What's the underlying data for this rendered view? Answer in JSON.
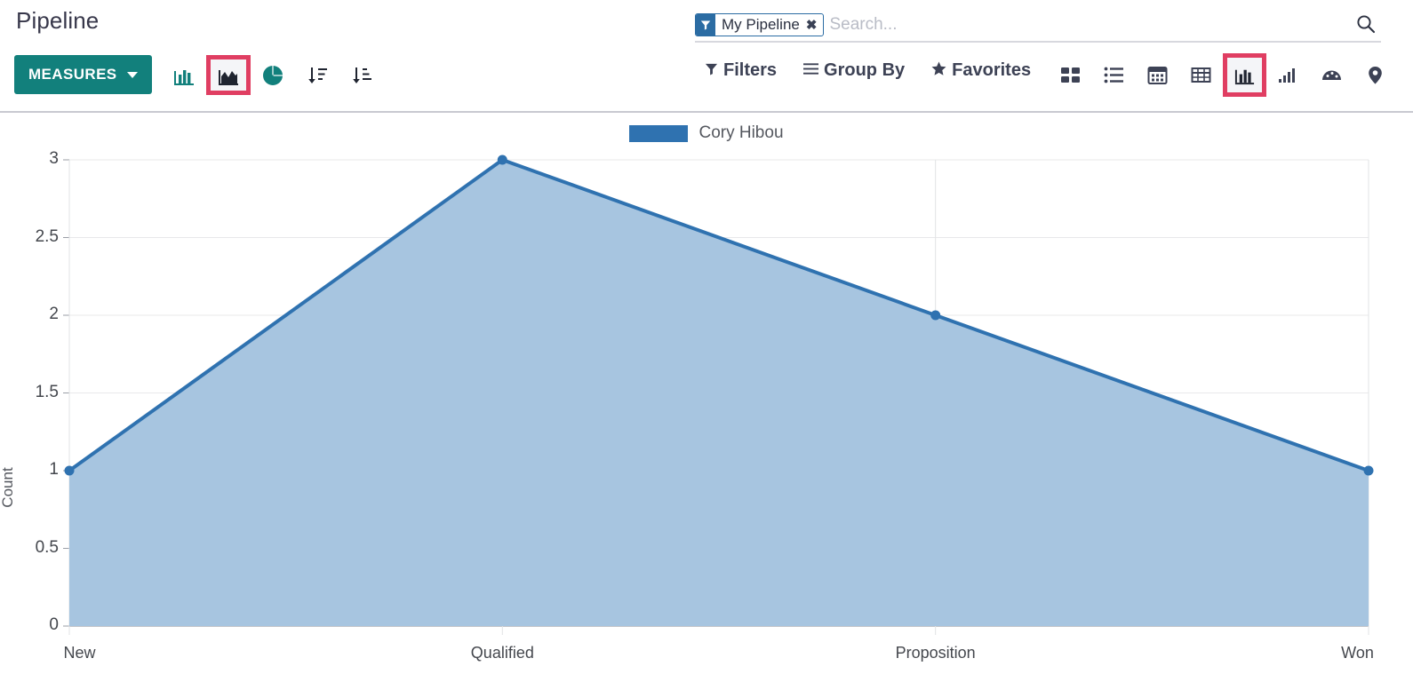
{
  "breadcrumb": "Pipeline",
  "search": {
    "placeholder": "Search...",
    "value": "",
    "facet": {
      "icon": "filter-icon",
      "label": "My Pipeline",
      "remove": "✖"
    },
    "search_icon": "search-icon"
  },
  "toolbar": {
    "measures_label": "MEASURES",
    "chart_tools": [
      {
        "name": "bar-chart-icon",
        "label": "Bar Chart",
        "active": false
      },
      {
        "name": "area-chart-icon",
        "label": "Line Chart",
        "active": true
      },
      {
        "name": "pie-chart-icon",
        "label": "Pie Chart",
        "active": false
      },
      {
        "name": "sort-descending-icon",
        "label": "Descending",
        "active": false
      },
      {
        "name": "sort-ascending-icon",
        "label": "Ascending",
        "active": false
      }
    ],
    "filters": [
      {
        "name": "filters",
        "icon": "funnel-icon",
        "label": "Filters"
      },
      {
        "name": "group-by",
        "icon": "bars-icon",
        "label": "Group By"
      },
      {
        "name": "favorites",
        "icon": "star-icon",
        "label": "Favorites"
      }
    ],
    "views": [
      {
        "name": "kanban-view-icon",
        "label": "Kanban",
        "active": false
      },
      {
        "name": "list-view-icon",
        "label": "List",
        "active": false
      },
      {
        "name": "calendar-view-icon",
        "label": "Calendar",
        "active": false
      },
      {
        "name": "pivot-view-icon",
        "label": "Pivot",
        "active": false
      },
      {
        "name": "graph-view-icon",
        "label": "Graph",
        "active": true
      },
      {
        "name": "cohort-view-icon",
        "label": "Cohort",
        "active": false
      },
      {
        "name": "dashboard-view-icon",
        "label": "Dashboard",
        "active": false
      },
      {
        "name": "map-view-icon",
        "label": "Map",
        "active": false
      }
    ]
  },
  "colors": {
    "brand_teal": "#12807c",
    "highlight_pink": "#e03e62",
    "series_line": "#2f72b0",
    "series_fill": "#a7c5e0",
    "facet_blue": "#2b6ca3"
  },
  "chart_data": {
    "type": "area",
    "title": "",
    "xlabel": "",
    "ylabel": "Count",
    "categories": [
      "New",
      "Qualified",
      "Proposition",
      "Won"
    ],
    "series": [
      {
        "name": "Cory Hibou",
        "values": [
          1,
          3,
          2,
          1
        ],
        "color": "#2f72b0",
        "fill": "#a7c5e0"
      }
    ],
    "ylim": [
      0,
      3
    ],
    "yticks": [
      0,
      0.5,
      1,
      1.5,
      2,
      2.5,
      3
    ],
    "ytick_labels": [
      "0",
      "0.5",
      "1",
      "1.5",
      "2",
      "2.5",
      "3"
    ],
    "grid": true,
    "legend_position": "top-center",
    "stacked": true
  }
}
